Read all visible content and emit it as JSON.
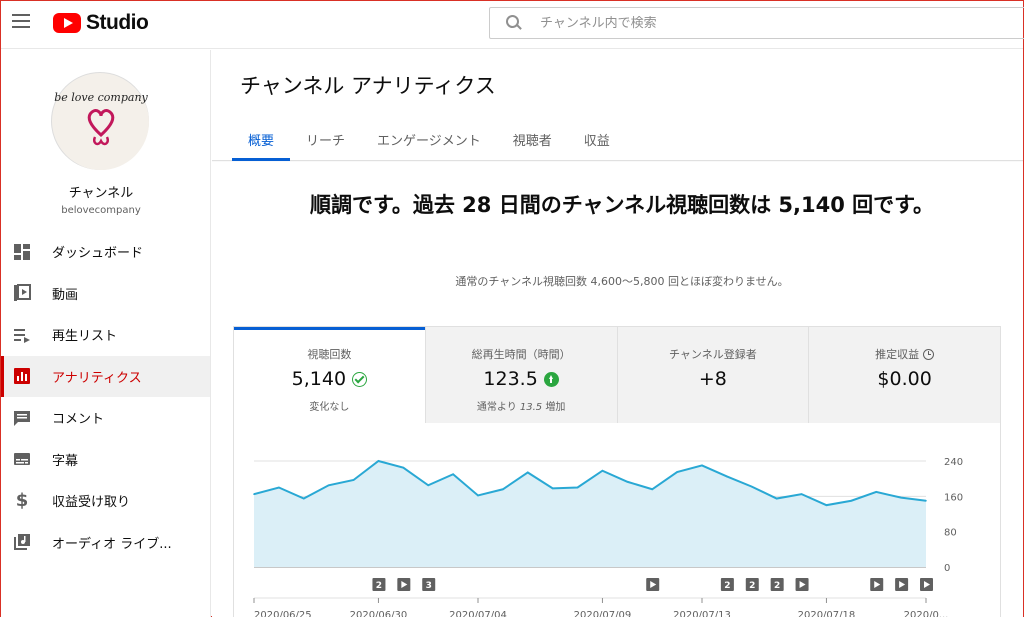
{
  "header": {
    "logo_text": "Studio",
    "search_placeholder": "チャンネル内で検索"
  },
  "sidebar": {
    "channel_name": "チャンネル",
    "channel_handle": "belovecompany",
    "avatar_text": "be love company",
    "items": [
      {
        "label": "ダッシュボード",
        "icon": "dashboard-icon"
      },
      {
        "label": "動画",
        "icon": "video-icon"
      },
      {
        "label": "再生リスト",
        "icon": "playlist-icon"
      },
      {
        "label": "アナリティクス",
        "icon": "analytics-icon",
        "active": true
      },
      {
        "label": "コメント",
        "icon": "comment-icon"
      },
      {
        "label": "字幕",
        "icon": "subtitle-icon"
      },
      {
        "label": "収益受け取り",
        "icon": "dollar-icon"
      },
      {
        "label": "オーディオ ライブ...",
        "icon": "audio-library-icon"
      }
    ]
  },
  "main": {
    "title": "チャンネル アナリティクス",
    "tabs": [
      "概要",
      "リーチ",
      "エンゲージメント",
      "視聴者",
      "収益"
    ],
    "active_tab": 0,
    "headline": "順調です。過去 28 日間のチャンネル視聴回数は 5,140 回です。",
    "subline": "通常のチャンネル視聴回数 4,600～5,800 回とほぼ変わりません。"
  },
  "metrics": [
    {
      "label": "視聴回数",
      "value": "5,140",
      "sub": "変化なし",
      "active": true
    },
    {
      "label": "総再生時間（時間）",
      "value": "123.5",
      "sub_prefix": "通常より ",
      "sub_em": "13.5",
      "sub_suffix": " 増加"
    },
    {
      "label": "チャンネル登録者",
      "value": "+8",
      "sub": ""
    },
    {
      "label": "推定収益",
      "value": "$0.00",
      "sub": ""
    }
  ],
  "colors": {
    "accent_blue": "#065fd4",
    "active_red": "#cc0000",
    "chart_line": "#29a8d4",
    "chart_fill": "#dbeff7",
    "success_green": "#2ba640"
  },
  "chart_data": {
    "type": "area",
    "ylim": [
      0,
      240
    ],
    "yticks": [
      "240",
      "160",
      "80",
      "0"
    ],
    "x": [
      "2020/06/25",
      "2020/06/26",
      "2020/06/27",
      "2020/06/28",
      "2020/06/29",
      "2020/06/30",
      "2020/07/01",
      "2020/07/02",
      "2020/07/03",
      "2020/07/04",
      "2020/07/05",
      "2020/07/06",
      "2020/07/07",
      "2020/07/08",
      "2020/07/09",
      "2020/07/10",
      "2020/07/11",
      "2020/07/12",
      "2020/07/13",
      "2020/07/14",
      "2020/07/15",
      "2020/07/16",
      "2020/07/17",
      "2020/07/18",
      "2020/07/19",
      "2020/07/20",
      "2020/07/21",
      "2020/07/22"
    ],
    "values": [
      165,
      180,
      155,
      185,
      197,
      240,
      225,
      185,
      210,
      162,
      176,
      214,
      178,
      180,
      218,
      193,
      176,
      215,
      230,
      205,
      182,
      155,
      165,
      140,
      150,
      170,
      157,
      150
    ],
    "xtick_labels": [
      "2020/06/25",
      "2020/06/30",
      "2020/07/04",
      "2020/07/09",
      "2020/07/13",
      "2020/07/18",
      "2020/0..."
    ],
    "xtick_index": [
      0,
      5,
      9,
      14,
      18,
      23,
      27
    ],
    "markers": [
      {
        "i": 5,
        "label": "2"
      },
      {
        "i": 6,
        "label": "▶"
      },
      {
        "i": 7,
        "label": "3"
      },
      {
        "i": 16,
        "label": "▶"
      },
      {
        "i": 19,
        "label": "2"
      },
      {
        "i": 20,
        "label": "2"
      },
      {
        "i": 21,
        "label": "2"
      },
      {
        "i": 22,
        "label": "▶"
      },
      {
        "i": 25,
        "label": "▶"
      },
      {
        "i": 26,
        "label": "▶"
      },
      {
        "i": 27,
        "label": "▶"
      }
    ]
  }
}
